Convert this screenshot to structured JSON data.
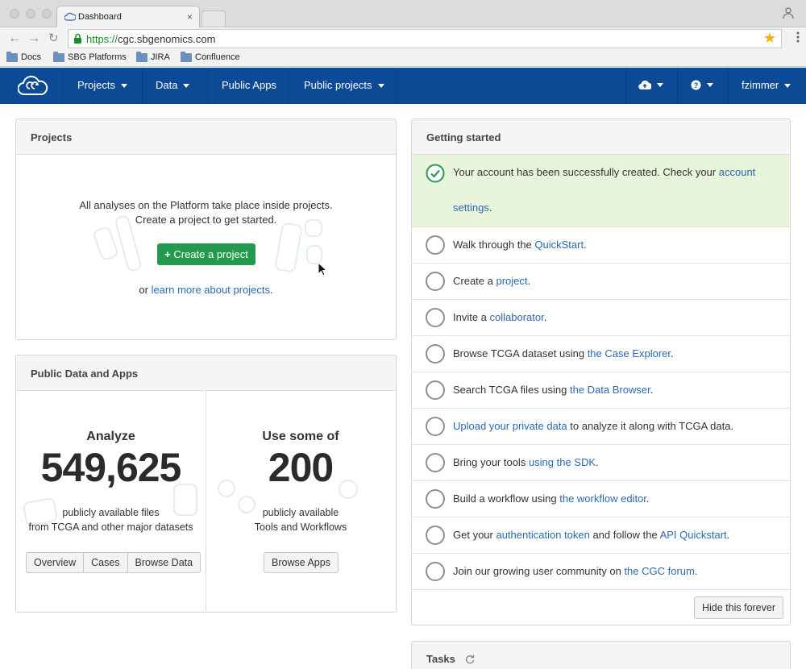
{
  "browser": {
    "tab_title": "Dashboard",
    "tab_close": "×",
    "url_scheme": "https://",
    "url_rest": "cgc.sbgenomics.com",
    "bookmarks": [
      "Docs",
      "SBG Platforms",
      "JIRA",
      "Confluence"
    ]
  },
  "navbar": {
    "logo_icon": "cgc-cloud-logo",
    "items": [
      "Projects",
      "Data",
      "Public Apps",
      "Public projects"
    ],
    "user": "fzimmer",
    "upload_icon": "cloud-upload-icon",
    "help_icon": "question-circle-icon",
    "brand_color": "#0d4a96"
  },
  "projects_panel": {
    "title": "Projects",
    "line1": "All analyses on the Platform take place inside projects.",
    "line2": "Create a project to get started.",
    "create_button": "Create a project",
    "learn_prefix": "or ",
    "learn_link": "learn more about projects",
    "learn_suffix": "."
  },
  "public_data_panel": {
    "title": "Public Data and Apps",
    "left": {
      "verb": "Analyze",
      "number": "549,625",
      "desc1": "publicly available files",
      "desc2": "from TCGA and other major datasets",
      "buttons": [
        "Overview",
        "Cases",
        "Browse Data"
      ]
    },
    "right": {
      "verb": "Use some of",
      "number": "200",
      "desc1": "publicly available",
      "desc2": "Tools and Workflows",
      "button": "Browse Apps"
    }
  },
  "getting_started": {
    "title": "Getting started",
    "success": {
      "pre": "Your account has been successfully created. Check your ",
      "link": "account settings",
      "post": "."
    },
    "steps": [
      {
        "pre": "Walk through the ",
        "link": "QuickStart",
        "post": ".",
        "done": false
      },
      {
        "pre": "Create a ",
        "link": "project",
        "post": ".",
        "done": false
      },
      {
        "pre": "Invite a ",
        "link": "collaborator",
        "post": ".",
        "done": false
      },
      {
        "pre": "Browse TCGA dataset using ",
        "link": "the Case Explorer",
        "post": ".",
        "done": false
      },
      {
        "pre": "Search TCGA files using ",
        "link": "the Data Browser",
        "post": ".",
        "done": false
      },
      {
        "pre": "",
        "link": "Upload your private data",
        "post": " to analyze it along with TCGA data.",
        "done": false
      },
      {
        "pre": "Bring your tools ",
        "link": "using the SDK",
        "post": ".",
        "done": false
      },
      {
        "pre": "Build a workflow using ",
        "link": "the workflow editor",
        "post": ".",
        "done": false
      },
      {
        "pre": "Get your ",
        "link": "authentication token",
        "post": " and follow the ",
        "link2": "API Quickstart",
        "post2": ".",
        "done": false
      },
      {
        "pre": "Join our growing user community on ",
        "link": "the CGC forum",
        "post": ".",
        "done": false
      }
    ],
    "hide_button": "Hide this forever"
  },
  "tasks_panel": {
    "title": "Tasks",
    "refresh_icon": "refresh-icon"
  },
  "colors": {
    "success_bg": "#e8f5dc",
    "success_check": "#249a4f",
    "link": "#2a6ab0",
    "create_button": "#249a4f"
  }
}
